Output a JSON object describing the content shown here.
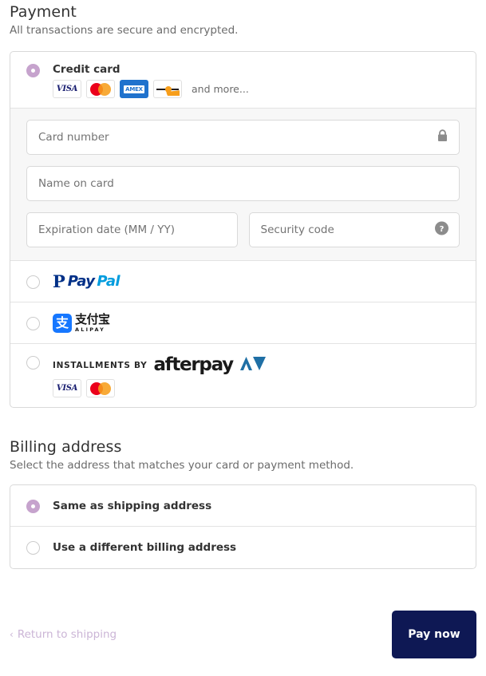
{
  "payment": {
    "title": "Payment",
    "subtitle": "All transactions are secure and encrypted.",
    "methods": [
      {
        "id": "credit-card",
        "label": "Credit card",
        "selected": true,
        "and_more": "and more...",
        "brands": [
          "visa",
          "mastercard",
          "amex",
          "discover"
        ]
      },
      {
        "id": "paypal",
        "label": "PayPal",
        "selected": false
      },
      {
        "id": "alipay",
        "label": "Alipay",
        "selected": false,
        "mark": "支",
        "cn": "支付宝",
        "en": "ALIPAY"
      },
      {
        "id": "afterpay",
        "label": "Afterpay",
        "selected": false,
        "installments_by": "INSTALLMENTS BY",
        "wordmark": "afterpay",
        "brands": [
          "visa",
          "mastercard"
        ]
      }
    ],
    "form": {
      "card_number_placeholder": "Card number",
      "card_number_value": "",
      "name_on_card_placeholder": "Name on card",
      "name_on_card_value": "",
      "expiration_placeholder": "Expiration date (MM / YY)",
      "expiration_value": "",
      "security_code_placeholder": "Security code",
      "security_code_value": "",
      "lock_icon": "lock-icon",
      "help_icon": "help-icon"
    }
  },
  "billing": {
    "title": "Billing address",
    "subtitle": "Select the address that matches your card or payment method.",
    "options": [
      {
        "id": "same-as-shipping",
        "label": "Same as shipping address",
        "selected": true
      },
      {
        "id": "different-billing",
        "label": "Use a different billing address",
        "selected": false
      }
    ]
  },
  "footer": {
    "return_label": "Return to shipping",
    "return_chevron": "‹",
    "pay_label": "Pay now"
  },
  "colors": {
    "accent_radio": "#c6a3cd",
    "pay_button": "#0e1854",
    "link": "#cbb5d6",
    "visa": "#1a1f71",
    "amex": "#1f72cd",
    "mastercard_red": "#eb001b",
    "mastercard_yellow": "#f79e1b",
    "alipay_blue": "#1677ff",
    "paypal_dark": "#003087",
    "paypal_light": "#009cde",
    "afterpay_mark": "#1f6fa5"
  },
  "brand_text": {
    "visa": "VISA",
    "amex": "AMEX",
    "paypal_p": "P",
    "paypal_pay": "Pay",
    "paypal_pal": "Pal"
  }
}
